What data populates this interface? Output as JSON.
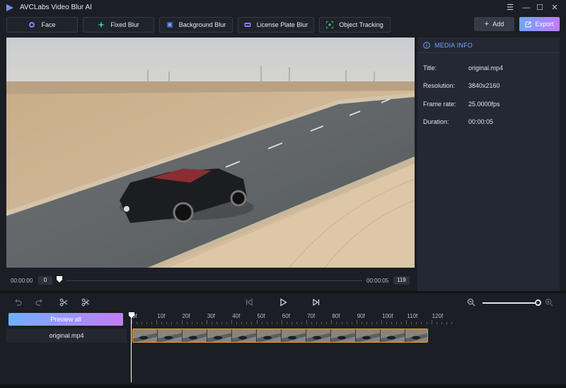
{
  "app": {
    "title": "AVCLabs Video Blur AI"
  },
  "window_controls": {
    "menu": "☰",
    "minimize": "—",
    "maximize": "☐",
    "close": "✕"
  },
  "modes": [
    {
      "label": "Face",
      "icon": "face-icon",
      "color": "#7b7bff"
    },
    {
      "label": "Fixed Blur",
      "icon": "fixed-blur-icon",
      "color": "#34d3a3"
    },
    {
      "label": "Background Blur",
      "icon": "background-blur-icon",
      "color": "#5b8cff"
    },
    {
      "label": "License Plate Blur",
      "icon": "license-plate-icon",
      "color": "#8d7bff"
    },
    {
      "label": "Object Tracking",
      "icon": "object-tracking-icon",
      "color": "#34d36b"
    }
  ],
  "toolbar": {
    "add_label": "Add",
    "export_label": "Export"
  },
  "player": {
    "time_start": "00:00:00",
    "frame_start": "0",
    "time_end": "00:00:05",
    "frame_end": "119",
    "position": 0
  },
  "media_info": {
    "header": "MEDIA INFO",
    "rows": [
      {
        "key": "Title:",
        "value": "original.mp4"
      },
      {
        "key": "Resolution:",
        "value": "3840x2160"
      },
      {
        "key": "Frame rate:",
        "value": "25.0000fps"
      },
      {
        "key": "Duration:",
        "value": "00:00:05"
      }
    ]
  },
  "timeline": {
    "preview_all_label": "Preview all",
    "track_name": "original.mp4",
    "ruler_labels": [
      "0f",
      "10f",
      "20f",
      "30f",
      "40f",
      "50f",
      "60f",
      "70f",
      "80f",
      "90f",
      "100f",
      "110f",
      "120f"
    ],
    "zoom_level": 1.0
  },
  "colors": {
    "accent_blue": "#6ea8ff",
    "export_gradient_start": "#6fa4ff",
    "export_gradient_end": "#c27bff",
    "clip_border": "#e0a32a"
  }
}
